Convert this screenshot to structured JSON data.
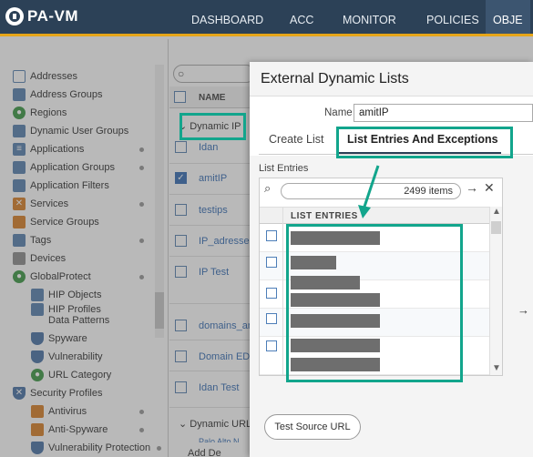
{
  "app": {
    "logo": "PA-VM"
  },
  "nav": [
    {
      "label": "DASHBOARD"
    },
    {
      "label": "ACC"
    },
    {
      "label": "MONITOR"
    },
    {
      "label": "POLICIES"
    },
    {
      "label": "OBJE"
    }
  ],
  "sidebar": {
    "items": [
      {
        "label": "Addresses",
        "icon": "address-icon"
      },
      {
        "label": "Address Groups",
        "icon": "address-group-icon"
      },
      {
        "label": "Regions",
        "icon": "globe-icon"
      },
      {
        "label": "Dynamic User Groups",
        "icon": "user-group-icon"
      },
      {
        "label": "Applications",
        "icon": "application-icon"
      },
      {
        "label": "Application Groups",
        "icon": "application-group-icon"
      },
      {
        "label": "Application Filters",
        "icon": "filter-icon"
      },
      {
        "label": "Services",
        "icon": "service-icon"
      },
      {
        "label": "Service Groups",
        "icon": "service-group-icon"
      },
      {
        "label": "Tags",
        "icon": "tag-icon"
      },
      {
        "label": "Devices",
        "icon": "device-icon"
      },
      {
        "label": "GlobalProtect",
        "icon": "globalprotect-icon"
      },
      {
        "label": "HIP Objects",
        "icon": "hip-object-icon"
      },
      {
        "label": "HIP Profiles",
        "icon": "hip-profile-icon"
      },
      {
        "label": "Data Patterns",
        "icon": "data-pattern-icon"
      },
      {
        "label": "Spyware",
        "icon": "spyware-icon"
      },
      {
        "label": "Vulnerability",
        "icon": "vulnerability-icon"
      },
      {
        "label": "URL Category",
        "icon": "url-category-icon"
      },
      {
        "label": "Security Profiles",
        "icon": "security-profile-icon"
      },
      {
        "label": "Antivirus",
        "icon": "antivirus-icon"
      },
      {
        "label": "Anti-Spyware",
        "icon": "anti-spyware-icon"
      },
      {
        "label": "Vulnerability Protection",
        "icon": "vulnerability-protection-icon"
      }
    ]
  },
  "list": {
    "column_name": "NAME",
    "group1": "Dynamic IP",
    "rows": [
      "Idan",
      "amitIP",
      "testips",
      "IP_adresses",
      "IP Test",
      "domains_an",
      "Domain ED",
      "Idan Test"
    ],
    "group2": "Dynamic URL",
    "bottom_row": "Palo Alto N",
    "bottom_actions": "Add  De"
  },
  "modal": {
    "title": "External Dynamic Lists",
    "name_label": "Name",
    "name_value": "amitIP",
    "tabs": {
      "create": "Create List",
      "entries": "List Entries And Exceptions"
    },
    "list_entries_label": "List Entries",
    "item_count": "2499 items",
    "column_header": "LIST ENTRIES",
    "test_button": "Test Source URL"
  },
  "colors": {
    "accent": "#12a58c",
    "topbar": "#2c4157",
    "topbar_border": "#e6a519"
  }
}
